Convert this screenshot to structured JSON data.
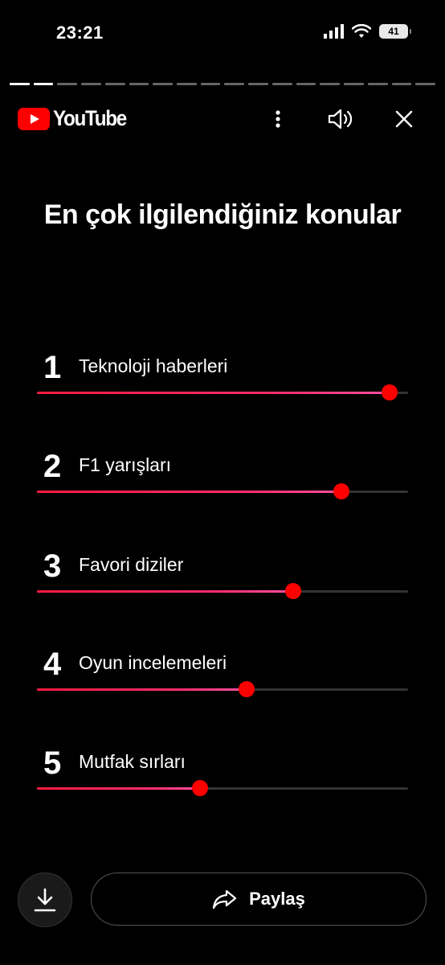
{
  "status": {
    "time": "23:21",
    "battery": "41"
  },
  "story_progress": {
    "total_segments": 18,
    "completed_segments": 2
  },
  "header": {
    "brand": "YouTube"
  },
  "title": "En çok ilgilendiğiniz konular",
  "topics": [
    {
      "rank": "1",
      "label": "Teknoloji haberleri",
      "level": 0.95
    },
    {
      "rank": "2",
      "label": "F1 yarışları",
      "level": 0.82
    },
    {
      "rank": "3",
      "label": "Favori diziler",
      "level": 0.69
    },
    {
      "rank": "4",
      "label": "Oyun incelemeleri",
      "level": 0.565
    },
    {
      "rank": "5",
      "label": "Mutfak sırları",
      "level": 0.44
    }
  ],
  "actions": {
    "share_label": "Paylaş"
  },
  "colors": {
    "accent": "#ff0000",
    "background": "#000000"
  },
  "icons": [
    "signal-icon",
    "wifi-icon",
    "battery-icon",
    "more-icon",
    "volume-icon",
    "close-icon",
    "download-icon",
    "share-icon"
  ]
}
